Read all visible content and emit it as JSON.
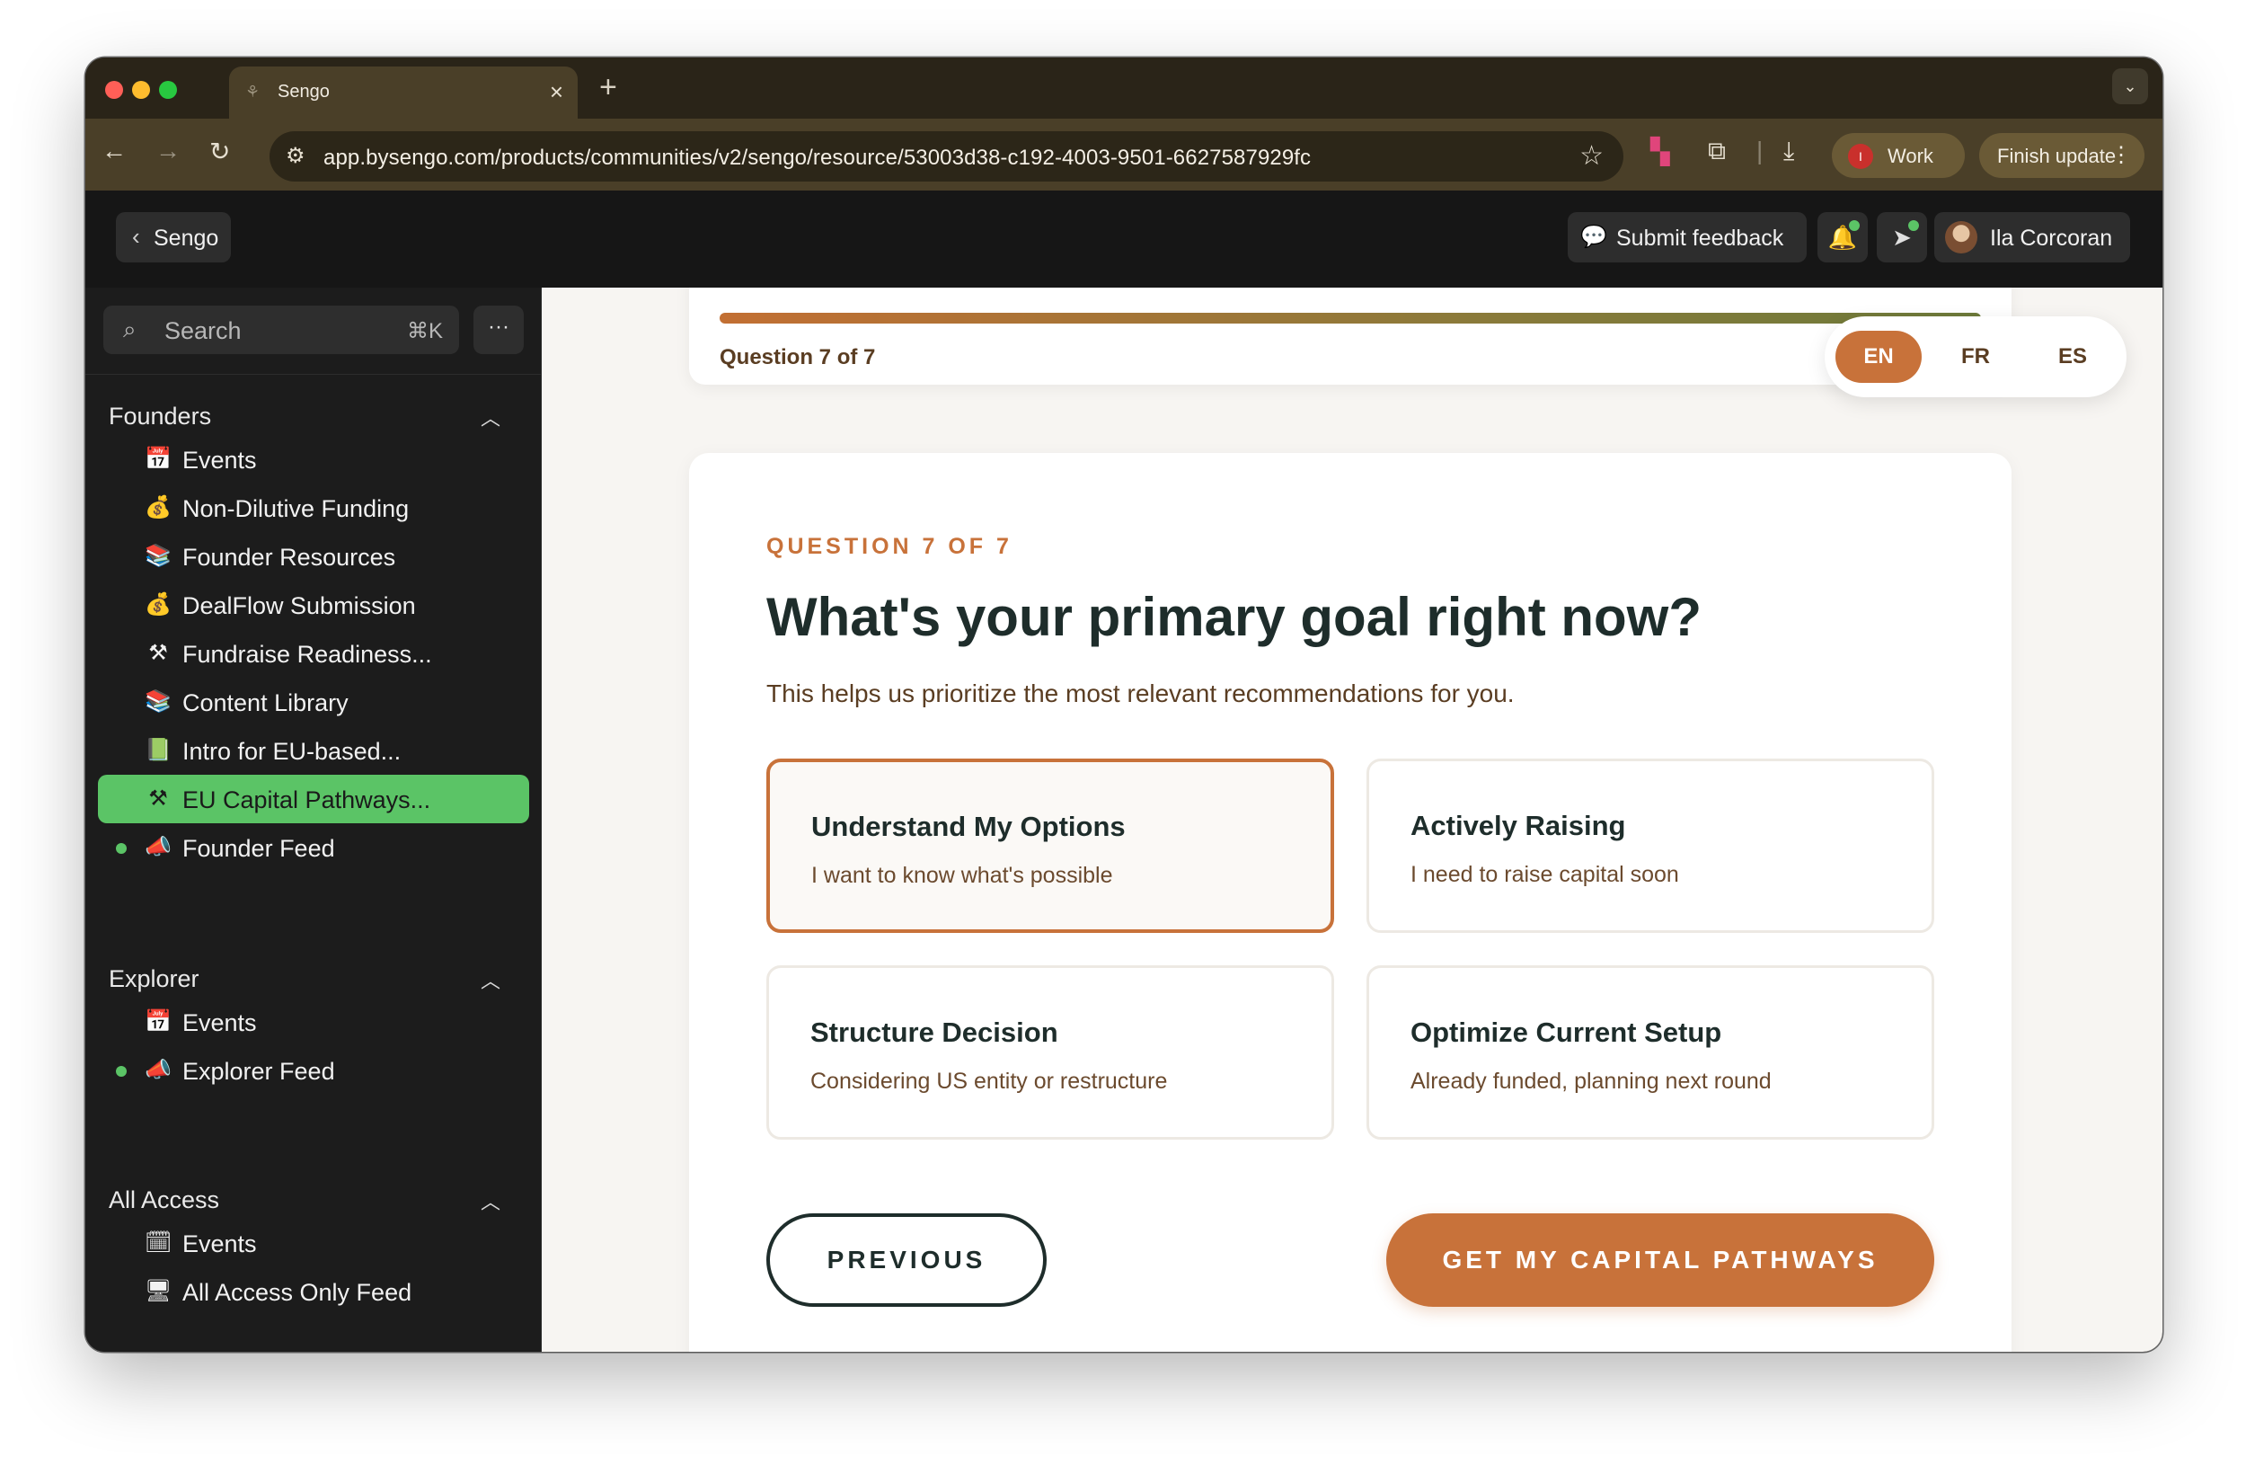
{
  "browser": {
    "tab_title": "Sengo",
    "url": "app.bysengo.com/products/communities/v2/sengo/resource/53003d38-c192-4003-9501-6627587929fc",
    "profile_label": "Work",
    "profile_initial": "I",
    "finish_update_label": "Finish update"
  },
  "header": {
    "back_label": "Sengo",
    "feedback_label": "Submit feedback",
    "user_name": "Ila Corcoran"
  },
  "sidebar": {
    "search_placeholder": "Search",
    "search_shortcut": "⌘K",
    "sections": [
      {
        "title": "Founders",
        "items": [
          {
            "icon": "calendar-icon",
            "glyph": "📅",
            "label": "Events"
          },
          {
            "icon": "money-bag-icon",
            "glyph": "💰",
            "label": "Non-Dilutive Funding"
          },
          {
            "icon": "books-icon",
            "glyph": "📚",
            "label": "Founder Resources"
          },
          {
            "icon": "money-bag-icon",
            "glyph": "💰",
            "label": "DealFlow Submission"
          },
          {
            "icon": "tools-icon",
            "glyph": "⚒",
            "label": "Fundraise Readiness..."
          },
          {
            "icon": "books-icon",
            "glyph": "📚",
            "label": "Content Library"
          },
          {
            "icon": "green-book-icon",
            "glyph": "📗",
            "label": "Intro for EU-based..."
          },
          {
            "icon": "tools-icon",
            "glyph": "⚒",
            "label": "EU Capital Pathways...",
            "active": true
          },
          {
            "icon": "megaphone-icon",
            "glyph": "📣",
            "label": "Founder Feed",
            "live": true
          }
        ]
      },
      {
        "title": "Explorer",
        "items": [
          {
            "icon": "calendar-icon",
            "glyph": "📅",
            "label": "Events"
          },
          {
            "icon": "megaphone-icon",
            "glyph": "📣",
            "label": "Explorer Feed",
            "live": true
          }
        ]
      },
      {
        "title": "All Access",
        "items": [
          {
            "icon": "calendar-outline-icon",
            "glyph": "🗓",
            "label": "Events"
          },
          {
            "icon": "monitor-icon",
            "glyph": "🖥",
            "label": "All Access Only Feed"
          }
        ]
      }
    ]
  },
  "quiz": {
    "progress_label": "Question 7 of 7",
    "progress_fraction": 1.0,
    "languages": [
      "EN",
      "FR",
      "ES"
    ],
    "selected_language": "EN",
    "kicker": "QUESTION 7 OF 7",
    "title": "What's your primary goal right now?",
    "subtitle": "This helps us prioritize the most relevant recommendations for you.",
    "options": [
      {
        "title": "Understand My Options",
        "desc": "I want to know what's possible",
        "selected": true
      },
      {
        "title": "Actively Raising",
        "desc": "I need to raise capital soon"
      },
      {
        "title": "Structure Decision",
        "desc": "Considering US entity or restructure"
      },
      {
        "title": "Optimize Current Setup",
        "desc": "Already funded, planning next round"
      }
    ],
    "previous_label": "PREVIOUS",
    "submit_label": "GET MY CAPITAL PATHWAYS"
  },
  "colors": {
    "accent": "#c8723a",
    "active_nav": "#5bc466",
    "heading": "#1e2d2b"
  }
}
